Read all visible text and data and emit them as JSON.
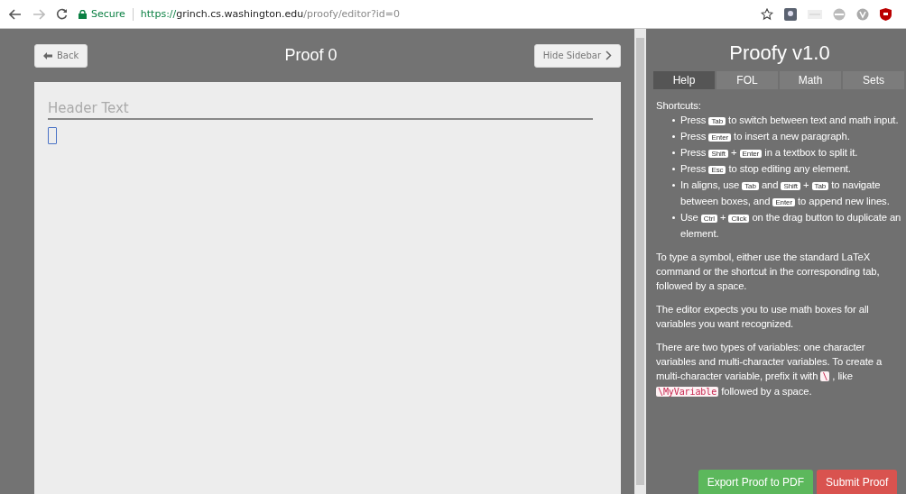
{
  "browser": {
    "security": "Secure",
    "url": {
      "scheme": "https://",
      "host": "grinch.cs.washington.edu",
      "path": "/proofy/editor?id=0"
    }
  },
  "editor": {
    "back": "Back",
    "title": "Proof 0",
    "hide_sidebar": "Hide Sidebar",
    "header": {
      "placeholder": "Header Text"
    }
  },
  "sidebar": {
    "title": "Proofy v1.0",
    "tabs": [
      {
        "label": "Help",
        "selected": true
      },
      {
        "label": "FOL",
        "selected": false
      },
      {
        "label": "Math",
        "selected": false
      },
      {
        "label": "Sets",
        "selected": false
      }
    ],
    "shortcuts_title": "Shortcuts:",
    "shortcuts": [
      [
        {
          "kind": "text",
          "text": "Press"
        },
        {
          "kind": "key",
          "text": "Tab"
        },
        {
          "kind": "text",
          "text": "to switch between text and math input."
        }
      ],
      [
        {
          "kind": "text",
          "text": "Press"
        },
        {
          "kind": "key",
          "text": "Enter"
        },
        {
          "kind": "text",
          "text": "to insert a new paragraph."
        }
      ],
      [
        {
          "kind": "text",
          "text": "Press"
        },
        {
          "kind": "key",
          "text": "Shift"
        },
        {
          "kind": "text",
          "text": "+"
        },
        {
          "kind": "key",
          "text": "Enter"
        },
        {
          "kind": "text",
          "text": "in a textbox to split it."
        }
      ],
      [
        {
          "kind": "text",
          "text": "Press"
        },
        {
          "kind": "key",
          "text": "Esc"
        },
        {
          "kind": "text",
          "text": "to stop editing any element."
        }
      ],
      [
        {
          "kind": "text",
          "text": "In aligns, use"
        },
        {
          "kind": "key",
          "text": "Tab"
        },
        {
          "kind": "text",
          "text": "and"
        },
        {
          "kind": "key",
          "text": "Shift"
        },
        {
          "kind": "text",
          "text": "+"
        },
        {
          "kind": "key",
          "text": "Tab"
        },
        {
          "kind": "text",
          "text": "to navigate between boxes, and"
        },
        {
          "kind": "key",
          "text": "Enter"
        },
        {
          "kind": "text",
          "text": "to append new lines."
        }
      ],
      [
        {
          "kind": "text",
          "text": "Use"
        },
        {
          "kind": "key",
          "text": "Ctrl"
        },
        {
          "kind": "text",
          "text": "+"
        },
        {
          "kind": "key",
          "text": "Click"
        },
        {
          "kind": "text",
          "text": "on the drag button to duplicate an element."
        }
      ]
    ],
    "paragraphs": [
      [
        {
          "kind": "text",
          "text": "To type a symbol, either use the standard LaTeX command or the shortcut in the corresponding tab, followed by a space."
        }
      ],
      [
        {
          "kind": "text",
          "text": "The editor expects you to use math boxes for all variables you want recognized."
        }
      ],
      [
        {
          "kind": "text",
          "text": "There are two types of variables: one character variables and multi-character variables. To create a multi-character variable, prefix it with"
        },
        {
          "kind": "code",
          "text": "\\"
        },
        {
          "kind": "text",
          "text": ", like"
        },
        {
          "kind": "code",
          "text": "\\MyVariable"
        },
        {
          "kind": "text",
          "text": "followed by a space."
        }
      ]
    ],
    "buttons": [
      {
        "label": "Export Proof to PDF",
        "kind": "success"
      },
      {
        "label": "Submit Proof",
        "kind": "danger"
      }
    ]
  }
}
